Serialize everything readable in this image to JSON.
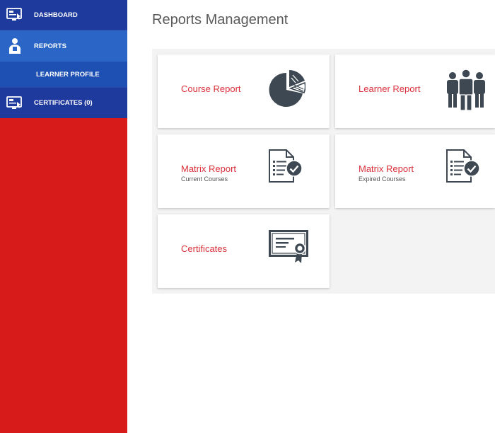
{
  "sidebar": {
    "items": [
      {
        "label": "DASHBOARD",
        "icon": "dashboard-icon"
      },
      {
        "label": "REPORTS",
        "icon": "reports-icon"
      },
      {
        "label": "LEARNER PROFILE"
      },
      {
        "label": "CERTIFICATES (0)",
        "icon": "certificates-icon"
      }
    ]
  },
  "main": {
    "title": "Reports Management",
    "cards": [
      {
        "title": "Course Report",
        "icon": "pie-chart-icon"
      },
      {
        "title": "Learner Report",
        "icon": "people-icon"
      },
      {
        "title": "Matrix Report",
        "subtitle": "Current Courses",
        "icon": "document-check-icon"
      },
      {
        "title": "Matrix Report",
        "subtitle": "Expired Courses",
        "icon": "document-check-icon"
      },
      {
        "title": "Certificates",
        "icon": "certificate-icon"
      }
    ]
  },
  "colors": {
    "sidebar_bg": "#d71a1a",
    "nav_dark": "#1d3a9c",
    "nav_active": "#2b66c6",
    "accent_text": "#d9303a",
    "icon_dark": "#3d4852"
  }
}
